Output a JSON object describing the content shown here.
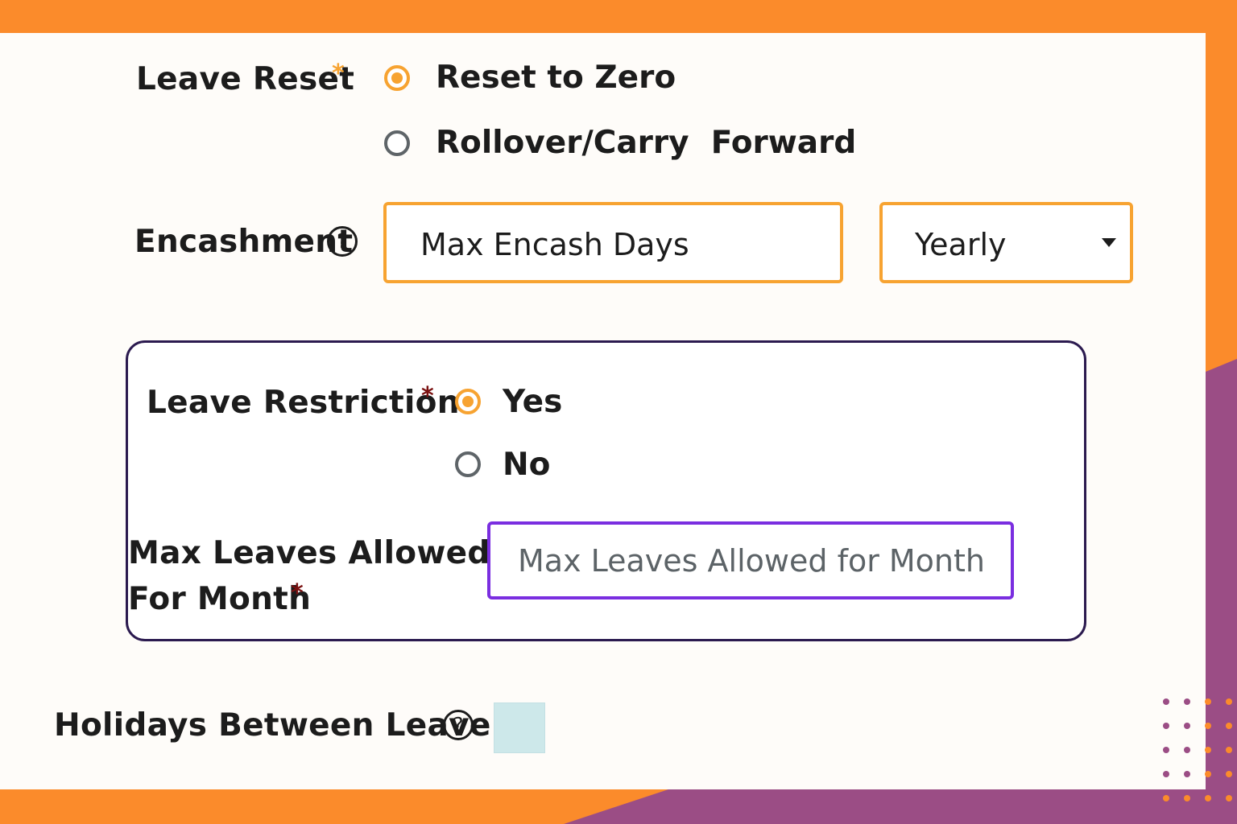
{
  "colors": {
    "accent_orange": "#f7a331",
    "frame_orange": "#fb8b2b",
    "frame_purple": "#9b4d85",
    "focus_purple": "#7a2ee0",
    "required_orange": "#f7a331",
    "required_dark_red": "#7a1010"
  },
  "leave_reset": {
    "label": "Leave Reset",
    "required_mark": "*",
    "options": [
      {
        "label": "Reset to Zero",
        "selected": true
      },
      {
        "label": "Rollover/Carry  Forward",
        "selected": false
      }
    ]
  },
  "encashment": {
    "label": "Encashment",
    "help_icon": "question-circle-icon",
    "help_glyph": "?",
    "max_days_placeholder": "Max Encash Days",
    "frequency": {
      "selected": "Yearly",
      "caret_icon": "caret-down-icon"
    }
  },
  "leave_restriction": {
    "label": "Leave Restriction",
    "required_mark": "*",
    "options": [
      {
        "label": "Yes",
        "selected": true
      },
      {
        "label": "No",
        "selected": false
      }
    ],
    "max_leaves": {
      "label_line1": "Max Leaves Allowed",
      "label_line2": "For Month",
      "required_mark": "*",
      "placeholder": "Max Leaves Allowed for Month",
      "value": ""
    }
  },
  "holidays_between_leave": {
    "label": "Holidays Between Leave",
    "help_icon": "question-circle-icon",
    "help_glyph": "?",
    "checked": false
  }
}
